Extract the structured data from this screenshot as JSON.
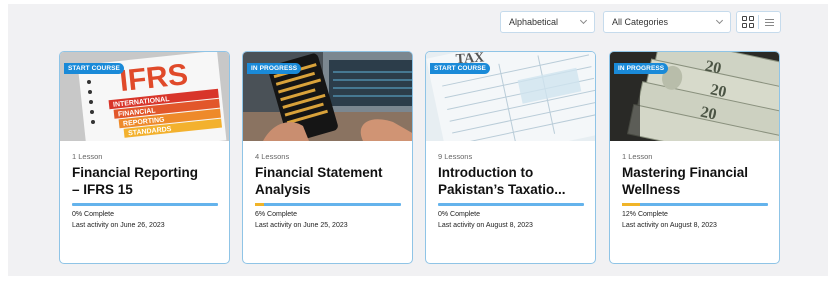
{
  "filters": {
    "sort_value": "Alphabetical",
    "category_value": "All Categories"
  },
  "view_toggle": {
    "grid_icon": "grid-icon",
    "list_icon": "list-icon"
  },
  "courses": [
    {
      "badge": "START COURSE",
      "lessons": "1 Lesson",
      "title": "Financial Reporting\n– IFRS 15",
      "progress_text": "0% Complete",
      "progress": 0.0,
      "activity": "Last activity on June 26, 2023",
      "thumbnail_words": [
        "IFRS",
        "INTERNATIONAL",
        "FINANCIAL",
        "REPORTING",
        "STANDARDS"
      ]
    },
    {
      "badge": "IN PROGRESS",
      "lessons": "4 Lessons",
      "title": "Financial Statement\nAnalysis",
      "progress_text": "6% Complete",
      "progress": 0.06,
      "activity": "Last activity on June 25, 2023",
      "thumbnail_words": []
    },
    {
      "badge": "START COURSE",
      "lessons": "9 Lessons",
      "title": "Introduction to\nPakistan’s Taxatio...",
      "progress_text": "0% Complete",
      "progress": 0.0,
      "activity": "Last activity on August 8, 2023",
      "thumbnail_words": [
        "TAX"
      ]
    },
    {
      "badge": "IN PROGRESS",
      "lessons": "1 Lesson",
      "title": "Mastering Financial\nWellness",
      "progress_text": "12% Complete",
      "progress": 0.12,
      "activity": "Last activity on August 8, 2023",
      "thumbnail_words": [
        "20",
        "20",
        "20"
      ]
    }
  ],
  "colors": {
    "accent": "#1a8ad8",
    "progress_track": "#64b3ec",
    "progress_fill": "#f0b429",
    "card_border": "#8fc4e6"
  }
}
